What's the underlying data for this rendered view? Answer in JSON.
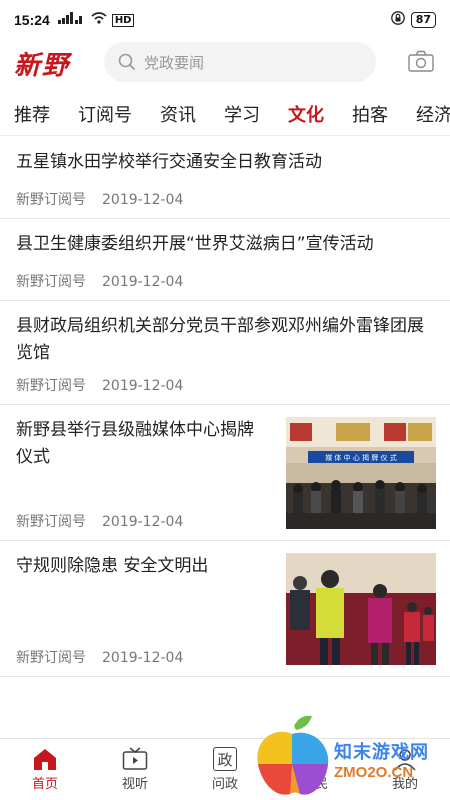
{
  "status_bar": {
    "time": "15:24",
    "signal_label": "HD",
    "battery": "87"
  },
  "header": {
    "logo": "新野",
    "search_placeholder": "党政要闻"
  },
  "tabs": [
    {
      "label": "推荐",
      "active": false
    },
    {
      "label": "订阅号",
      "active": false
    },
    {
      "label": "资讯",
      "active": false
    },
    {
      "label": "学习",
      "active": false
    },
    {
      "label": "文化",
      "active": true
    },
    {
      "label": "拍客",
      "active": false
    },
    {
      "label": "经济",
      "active": false
    }
  ],
  "news": [
    {
      "title": "五星镇水田学校举行交通安全日教育活动",
      "source": "新野订阅号",
      "date": "2019-12-04"
    },
    {
      "title": "县卫生健康委组织开展“世界艾滋病日”宣传活动",
      "source": "新野订阅号",
      "date": "2019-12-04"
    },
    {
      "title": "县财政局组织机关部分党员干部参观邓州编外雷锋团展览馆",
      "source": "新野订阅号",
      "date": "2019-12-04"
    },
    {
      "title": "新野县举行县级融媒体中心揭牌仪式",
      "source": "新野订阅号",
      "date": "2019-12-04",
      "thumb_caption": "媒 体 中 心 揭 牌 仪 式"
    },
    {
      "title": "守规则除隐患 安全文明出",
      "source": "新野订阅号",
      "date": "2019-12-04"
    }
  ],
  "bottom_nav": [
    {
      "label": "首页",
      "icon": "home-icon",
      "active": true
    },
    {
      "label": "视听",
      "icon": "tv-icon",
      "active": false
    },
    {
      "label": "问政",
      "icon": "politics-icon",
      "icon_text": "政",
      "active": false
    },
    {
      "label": "便民",
      "icon": "service-icon",
      "active": false
    },
    {
      "label": "我的",
      "icon": "user-icon",
      "active": false
    }
  ],
  "watermark": {
    "text": "知末游戏网",
    "url": "ZMO2O.CN"
  },
  "colors": {
    "accent": "#c8161d",
    "text": "#222222",
    "meta": "#777777"
  }
}
